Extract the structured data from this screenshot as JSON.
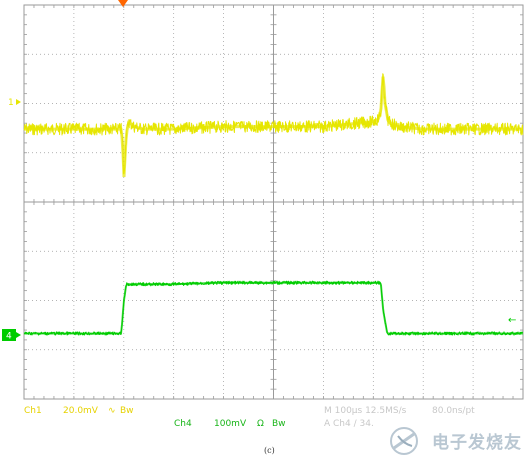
{
  "chart_data": {
    "type": "line",
    "title": "",
    "xlabel": "",
    "ylabel": "",
    "grid": true,
    "divisions": {
      "x": 10,
      "y": 8
    },
    "x_unit": "div",
    "xlim": [
      0,
      10
    ],
    "series": [
      {
        "name": "Ch1",
        "color": "#e6e600",
        "y_unit": "div from Ch1 marker",
        "x": [
          0,
          1.95,
          1.98,
          2.0,
          2.02,
          2.05,
          2.1,
          2.2,
          2.4,
          3.0,
          4.0,
          5.0,
          6.0,
          6.5,
          7.0,
          7.1,
          7.15,
          7.18,
          7.2,
          7.23,
          7.3,
          7.5,
          8.0,
          9.0,
          10.0
        ],
        "values": [
          -0.55,
          -0.55,
          -0.9,
          -1.6,
          -1.2,
          -0.65,
          -0.4,
          -0.5,
          -0.55,
          -0.55,
          -0.5,
          -0.5,
          -0.5,
          -0.45,
          -0.4,
          -0.35,
          -0.2,
          0.3,
          0.6,
          0.0,
          -0.4,
          -0.5,
          -0.55,
          -0.55,
          -0.55
        ]
      },
      {
        "name": "Ch4",
        "color": "#00cc00",
        "y_unit": "div from Ch4 marker",
        "x": [
          0,
          1.95,
          2.0,
          2.05,
          3.0,
          4.0,
          5.0,
          6.0,
          7.0,
          7.15,
          7.2,
          7.28,
          7.35,
          8.0,
          9.0,
          10.0
        ],
        "values": [
          -0.05,
          -0.05,
          0.6,
          0.95,
          0.95,
          0.98,
          0.98,
          0.98,
          0.98,
          0.98,
          0.4,
          -0.05,
          -0.05,
          -0.05,
          -0.05,
          -0.05
        ]
      }
    ],
    "markers": {
      "top_trigger": "▼",
      "ch1": "1",
      "ch4": "4",
      "right_arrow": "←"
    }
  },
  "status": {
    "ch1_label": "Ch1",
    "ch1_scale": "20.0mV",
    "ch1_coupling": "∿",
    "ch1_bw": "Bw",
    "ch4_label": "Ch4",
    "ch4_scale": "100mV",
    "ch4_ohm": "Ω",
    "ch4_bw": "Bw",
    "timebase": "M 100µs 12.5MS/s",
    "sample": "80.0ns/pt",
    "trigger": "A  Ch4  ∕  34."
  },
  "caption": "(c)",
  "watermark": "电子发烧友",
  "colors": {
    "grid": "#9a9a9a",
    "ch1": "#e6e600",
    "ch4": "#00cc00",
    "trigger_marker": "#ff6600"
  }
}
